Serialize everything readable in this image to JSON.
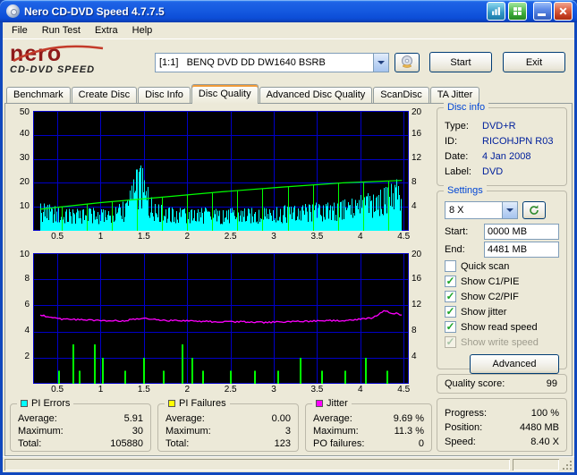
{
  "window": {
    "title": "Nero CD-DVD Speed 4.7.7.5"
  },
  "menu": {
    "items": [
      "File",
      "Run Test",
      "Extra",
      "Help"
    ]
  },
  "logo": {
    "brand": "nero",
    "product": "CD-DVD SPEED"
  },
  "toolbar": {
    "drive_select": "[1:1]   BENQ DVD DD DW1640 BSRB",
    "start_label": "Start",
    "exit_label": "Exit"
  },
  "tabs": [
    {
      "label": "Benchmark",
      "active": false
    },
    {
      "label": "Create Disc",
      "active": false
    },
    {
      "label": "Disc Info",
      "active": false
    },
    {
      "label": "Disc Quality",
      "active": true
    },
    {
      "label": "Advanced Disc Quality",
      "active": false
    },
    {
      "label": "ScanDisc",
      "active": false
    },
    {
      "label": "TA Jitter",
      "active": false
    }
  ],
  "disc_info": {
    "title": "Disc info",
    "rows": [
      {
        "label": "Type:",
        "value": "DVD+R"
      },
      {
        "label": "ID:",
        "value": "RICOHJPN R03"
      },
      {
        "label": "Date:",
        "value": "4 Jan 2008"
      },
      {
        "label": "Label:",
        "value": "DVD"
      }
    ]
  },
  "settings": {
    "title": "Settings",
    "speed_value": "8 X",
    "start_label": "Start:",
    "start_value": "0000 MB",
    "end_label": "End:",
    "end_value": "4481 MB",
    "checkboxes": [
      {
        "label": "Quick scan",
        "checked": false,
        "enabled": true
      },
      {
        "label": "Show C1/PIE",
        "checked": true,
        "enabled": true
      },
      {
        "label": "Show C2/PIF",
        "checked": true,
        "enabled": true
      },
      {
        "label": "Show jitter",
        "checked": true,
        "enabled": true
      },
      {
        "label": "Show read speed",
        "checked": true,
        "enabled": true
      },
      {
        "label": "Show write speed",
        "checked": true,
        "enabled": false
      }
    ],
    "advanced_label": "Advanced"
  },
  "quality": {
    "label": "Quality score:",
    "value": "99"
  },
  "progress": {
    "rows": [
      {
        "label": "Progress:",
        "value": "100 %"
      },
      {
        "label": "Position:",
        "value": "4480 MB"
      },
      {
        "label": "Speed:",
        "value": "8.40 X"
      }
    ]
  },
  "stats": [
    {
      "title": "PI Errors",
      "swatch": "#00FFFF",
      "rows": [
        {
          "label": "Average:",
          "value": "5.91"
        },
        {
          "label": "Maximum:",
          "value": "30"
        },
        {
          "label": "Total:",
          "value": "105880"
        }
      ]
    },
    {
      "title": "PI Failures",
      "swatch": "#FFFF00",
      "rows": [
        {
          "label": "Average:",
          "value": "0.00"
        },
        {
          "label": "Maximum:",
          "value": "3"
        },
        {
          "label": "Total:",
          "value": "123"
        }
      ]
    },
    {
      "title": "Jitter",
      "swatch": "#FF00FF",
      "rows": [
        {
          "label": "Average:",
          "value": "9.69 %"
        },
        {
          "label": "Maximum:",
          "value": "11.3 %"
        },
        {
          "label": "PO failures:",
          "value": "0"
        }
      ]
    }
  ],
  "chart_data": [
    {
      "type": "area",
      "name": "pi-errors-and-read-speed",
      "x_min": 0.22,
      "x_max": 4.56,
      "x_ticks": [
        0.5,
        1,
        1.5,
        2,
        2.5,
        3,
        3.5,
        4,
        4.5
      ],
      "x_tick_labels": [
        "0.5",
        "1",
        "1.5",
        "2",
        "2.5",
        "3",
        "3.5",
        "4",
        "4.5"
      ],
      "left_axis": {
        "min": 0,
        "max": 50,
        "ticks": [
          10,
          20,
          30,
          40,
          50
        ]
      },
      "right_axis": {
        "min": 0,
        "max": 20,
        "ticks": [
          4,
          8,
          12,
          16,
          20
        ]
      },
      "grid_color": "#0000C8",
      "series": [
        {
          "id": "pie",
          "name": "PI Errors",
          "type": "noisy-area",
          "axis": "left",
          "color": "#00FFFF",
          "points": [
            [
              0.3,
              13
            ],
            [
              0.42,
              11
            ],
            [
              0.55,
              9.5
            ],
            [
              0.7,
              9
            ],
            [
              0.85,
              10
            ],
            [
              1.0,
              9
            ],
            [
              1.15,
              10
            ],
            [
              1.3,
              13
            ],
            [
              1.38,
              22
            ],
            [
              1.44,
              30
            ],
            [
              1.5,
              25
            ],
            [
              1.56,
              17
            ],
            [
              1.65,
              12
            ],
            [
              1.8,
              10
            ],
            [
              2.0,
              9.5
            ],
            [
              2.2,
              10
            ],
            [
              2.4,
              9
            ],
            [
              2.6,
              10
            ],
            [
              2.8,
              9.5
            ],
            [
              3.0,
              10
            ],
            [
              3.2,
              11
            ],
            [
              3.4,
              11.5
            ],
            [
              3.6,
              12
            ],
            [
              3.8,
              13
            ],
            [
              4.0,
              15
            ],
            [
              4.15,
              17
            ],
            [
              4.25,
              18
            ],
            [
              4.35,
              20
            ],
            [
              4.42,
              22
            ],
            [
              4.48,
              16
            ]
          ]
        },
        {
          "id": "speed-dips",
          "name": "read-speed-dips",
          "type": "vlines",
          "axis": "right",
          "color": "#00FF00",
          "follow": "speed",
          "xs": [
            0.55,
            0.84,
            1.13,
            1.42,
            1.71,
            2.0,
            2.29,
            2.58,
            2.87,
            3.16,
            3.45,
            3.74,
            4.03,
            4.32
          ]
        },
        {
          "id": "speed",
          "name": "Read speed",
          "type": "line",
          "axis": "right",
          "color": "#00FF00",
          "points": [
            [
              0.3,
              3.6
            ],
            [
              1.0,
              4.7
            ],
            [
              1.7,
              5.6
            ],
            [
              2.4,
              6.5
            ],
            [
              3.1,
              7.3
            ],
            [
              3.8,
              8.0
            ],
            [
              4.48,
              8.4
            ]
          ]
        }
      ]
    },
    {
      "type": "line",
      "name": "pi-failures-and-jitter",
      "x_min": 0.22,
      "x_max": 4.56,
      "x_ticks": [
        0.5,
        1,
        1.5,
        2,
        2.5,
        3,
        3.5,
        4,
        4.5
      ],
      "x_tick_labels": [
        "0.5",
        "1",
        "1.5",
        "2",
        "2.5",
        "3",
        "3.5",
        "4",
        "4.5"
      ],
      "left_axis": {
        "min": 0,
        "max": 10,
        "ticks": [
          2,
          4,
          6,
          8,
          10
        ]
      },
      "right_axis": {
        "min": 0,
        "max": 20,
        "ticks": [
          4,
          8,
          12,
          16,
          20
        ]
      },
      "grid_color": "#0000C8",
      "series": [
        {
          "id": "pif",
          "name": "PI Failures",
          "type": "bars",
          "axis": "left",
          "color": "#00FF00",
          "points": [
            [
              0.52,
              1
            ],
            [
              0.68,
              3
            ],
            [
              0.76,
              1
            ],
            [
              0.93,
              3
            ],
            [
              1.03,
              2
            ],
            [
              1.28,
              1
            ],
            [
              1.5,
              2
            ],
            [
              1.73,
              1
            ],
            [
              1.95,
              3
            ],
            [
              2.06,
              2
            ],
            [
              2.18,
              1
            ],
            [
              2.5,
              1
            ],
            [
              2.78,
              1
            ],
            [
              3.05,
              1
            ],
            [
              3.31,
              2
            ],
            [
              3.56,
              1
            ],
            [
              3.83,
              1
            ],
            [
              4.06,
              2
            ],
            [
              4.31,
              1
            ]
          ]
        },
        {
          "id": "jitter",
          "name": "Jitter",
          "type": "noisy-line",
          "axis": "right",
          "color": "#FF00FF",
          "noise": 0.12,
          "points": [
            [
              0.3,
              10.6
            ],
            [
              0.4,
              10.2
            ],
            [
              0.55,
              9.9
            ],
            [
              0.75,
              9.8
            ],
            [
              1.0,
              9.7
            ],
            [
              1.25,
              9.6
            ],
            [
              1.4,
              9.9
            ],
            [
              1.52,
              10.0
            ],
            [
              1.7,
              9.7
            ],
            [
              2.0,
              9.6
            ],
            [
              2.3,
              9.5
            ],
            [
              2.6,
              9.5
            ],
            [
              2.9,
              9.4
            ],
            [
              3.2,
              9.5
            ],
            [
              3.5,
              9.6
            ],
            [
              3.8,
              9.7
            ],
            [
              4.0,
              9.9
            ],
            [
              4.15,
              10.1
            ],
            [
              4.28,
              11.3
            ],
            [
              4.35,
              10.7
            ],
            [
              4.42,
              10.8
            ],
            [
              4.48,
              10.5
            ]
          ]
        }
      ]
    }
  ]
}
